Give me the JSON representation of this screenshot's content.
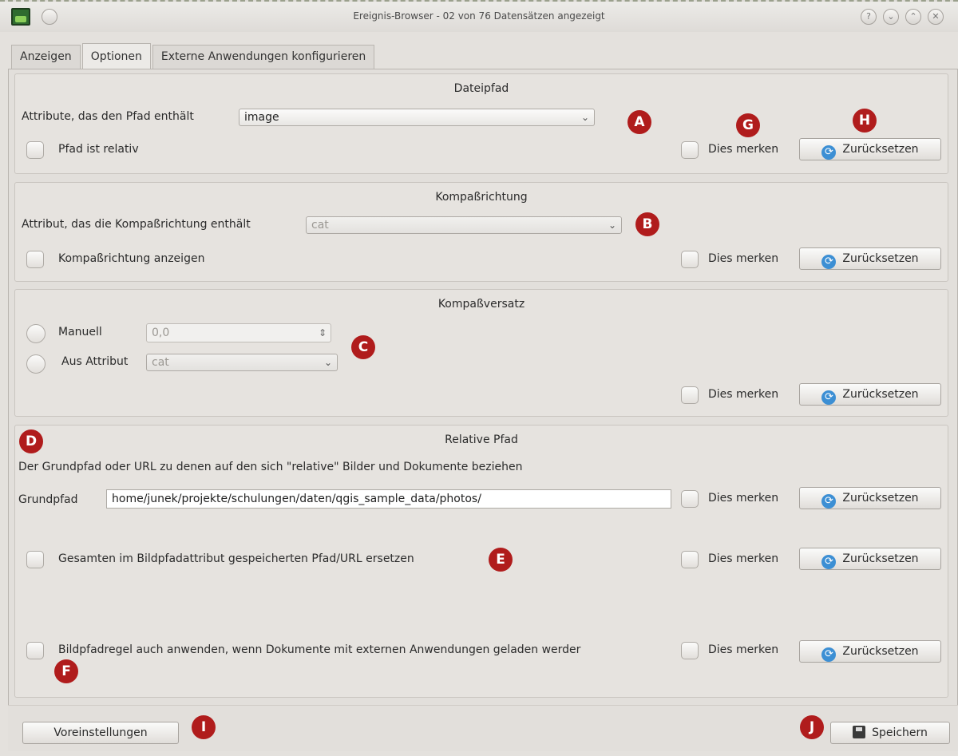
{
  "window": {
    "title": "Ereignis-Browser - 02 von 76 Datensätzen angezeigt",
    "controls": [
      "?",
      "⌄",
      "⌃",
      "✕"
    ]
  },
  "tabs": [
    {
      "label": "Anzeigen",
      "active": false
    },
    {
      "label": "Optionen",
      "active": true
    },
    {
      "label": "Externe Anwendungen konfigurieren",
      "active": false
    }
  ],
  "dateipfad": {
    "title": "Dateipfad",
    "attribute_label": "Attribute, das den Pfad enthält",
    "attribute_value": "image",
    "relative_label": "Pfad ist relativ"
  },
  "kompassrichtung": {
    "title": "Kompaßrichtung",
    "attribute_label": "Attribut, das die Kompaßrichtung enthält",
    "attribute_value": "cat",
    "show_label": "Kompaßrichtung anzeigen"
  },
  "kompassversatz": {
    "title": "Kompaßversatz",
    "manual_label": "Manuell",
    "manual_value": "0,0",
    "from_attr_label": "Aus Attribut",
    "from_attr_value": "cat"
  },
  "relative_pfad": {
    "title": "Relative Pfad",
    "description": "Der Grundpfad oder URL zu denen auf den sich \"relative\" Bilder und Dokumente beziehen",
    "base_path_label": "Grundpfad",
    "base_path_value": "home/junek/projekte/schulungen/daten/qgis_sample_data/photos/",
    "replace_label": "Gesamten im Bildpfadattribut gespeicherten Pfad/URL ersetzen",
    "apply_label": "Bildpfadregel auch anwenden, wenn Dokumente mit externen Anwendungen geladen werder"
  },
  "common": {
    "remember_label": "Dies merken",
    "reset_label": "Zurücksetzen"
  },
  "bottom": {
    "defaults_label": "Voreinstellungen",
    "save_label": "Speichern"
  },
  "markers": [
    "A",
    "B",
    "C",
    "D",
    "E",
    "F",
    "G",
    "H",
    "I",
    "J"
  ],
  "colors": {
    "marker": "#b01c1c",
    "reset_icon": "#3c8fd4"
  }
}
